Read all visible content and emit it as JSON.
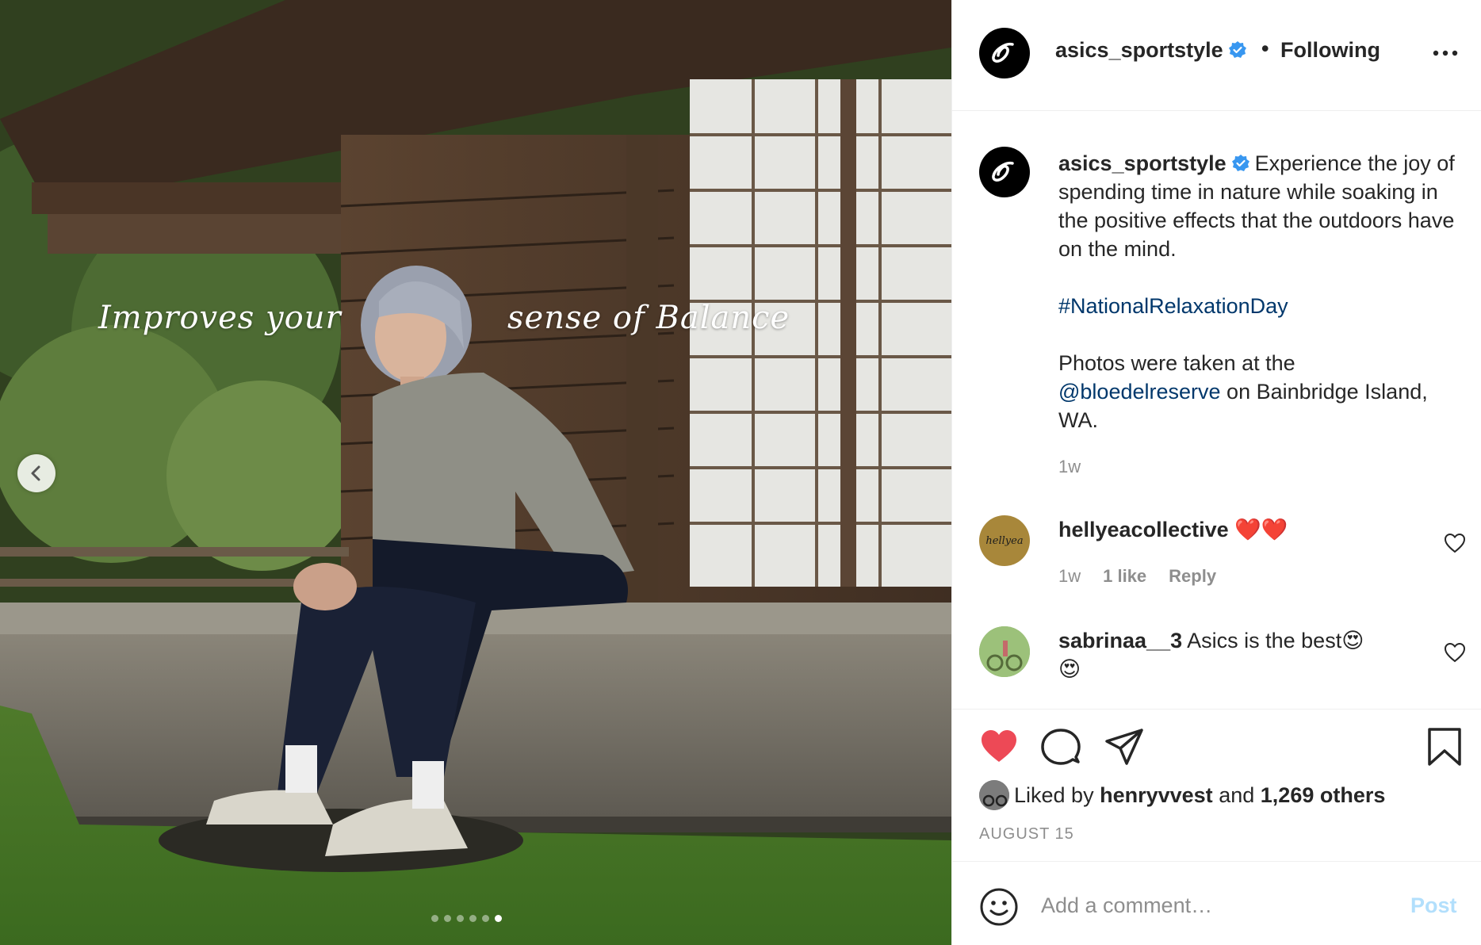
{
  "post": {
    "username": "asics_sportstyle",
    "follow_status": "Following",
    "separator": "•",
    "photo_overlay": {
      "left_text": "Improves your",
      "right_text": "sense of Balance"
    },
    "carousel": {
      "total_slides": 6,
      "active_index": 5
    },
    "caption": {
      "username": "asics_sportstyle",
      "line1": "Experience the joy of spending time in nature while soaking in the positive effects that the outdoors have on the mind.",
      "hashtag": "#NationalRelaxationDay",
      "photos_prefix": "Photos were taken at the",
      "mention": "@bloedelreserve",
      "photos_suffix": "on Bainbridge Island, WA.",
      "time": "1w"
    },
    "comments": [
      {
        "username": "hellyeacollective",
        "text": "❤️❤️",
        "time": "1w",
        "likes": "1 like",
        "reply": "Reply",
        "avatar_text": "hellyea"
      },
      {
        "username": "sabrinaa__3",
        "text": "Asics is the best😍",
        "text2": "😍"
      }
    ],
    "likes": {
      "prefix": "Liked by",
      "user": "henryvvest",
      "middle": "and",
      "others": "1,269 others"
    },
    "date": "AUGUST 15",
    "add_comment": {
      "placeholder": "Add a comment…",
      "post_label": "Post"
    },
    "colors": {
      "like": "#ed4956",
      "link": "#00376b",
      "verified": "#3897f0",
      "post_disabled": "#b2dffc"
    }
  }
}
